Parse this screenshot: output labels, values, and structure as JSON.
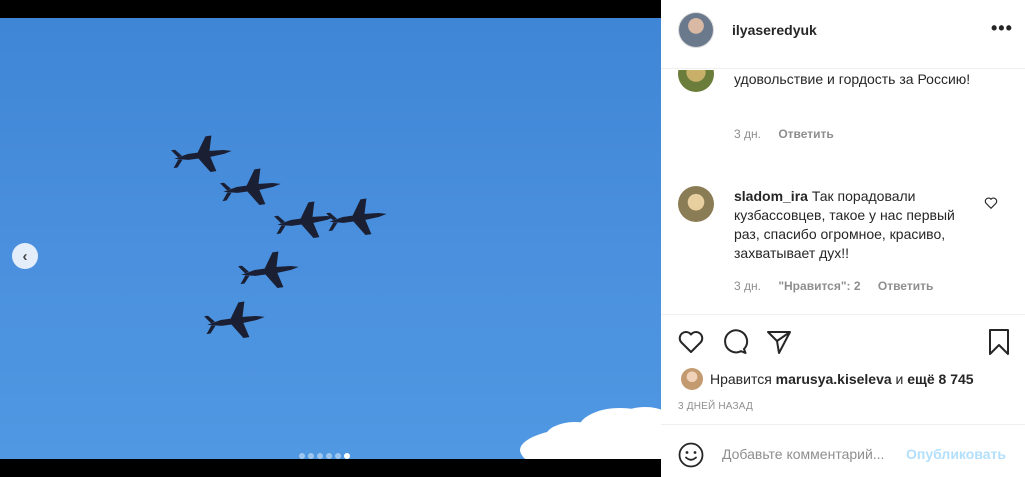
{
  "media": {
    "prev_icon": "chevron-left-icon",
    "carousel_total": 6,
    "carousel_active": 6
  },
  "header": {
    "username": "ilyaseredyuk",
    "more_label": "•••"
  },
  "comments": [
    {
      "username": "",
      "text": "спасибо за доставленное удовольствие и гордость за Россию!",
      "age": "3 дн.",
      "likes_label": "",
      "reply_label": "Ответить"
    },
    {
      "username": "sladom_ira",
      "text": "Так порадовали кузбассовцев, такое у нас первый раз, спасибо огромное, красиво, захватывает дух!!",
      "age": "3 дн.",
      "likes_label": "\"Нравится\": 2",
      "reply_label": "Ответить"
    }
  ],
  "actions": {
    "icons": [
      "heart-icon",
      "comment-icon",
      "share-icon",
      "bookmark-icon"
    ]
  },
  "likes": {
    "prefix": "Нравится",
    "user": "marusya.kiseleva",
    "middle": "и",
    "others": "ещё 8 745"
  },
  "date": "3 дней назад",
  "add_comment": {
    "placeholder": "Добавьте комментарий...",
    "post_label": "Опубликовать",
    "emoji_icon": "smiley-icon"
  },
  "colors": {
    "sky": "#4a90de",
    "link_disabled": "#b2dffc",
    "meta_gray": "#8e8e8e"
  }
}
